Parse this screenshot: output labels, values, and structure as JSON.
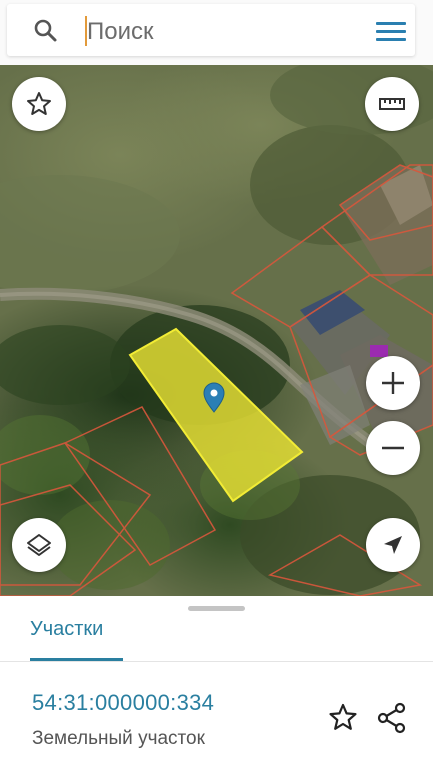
{
  "search": {
    "placeholder": "Поиск",
    "search_icon": "search-icon",
    "menu_icon": "hamburger-menu-icon"
  },
  "map": {
    "controls": {
      "favorite": "star-icon",
      "ruler": "ruler-icon",
      "zoom_in": "plus-icon",
      "zoom_out": "minus-icon",
      "layers": "layers-icon",
      "locate": "navigation-arrow-icon"
    },
    "selected_parcel_fill": "#e6e033",
    "parcel_border_color": "#d8573c",
    "marker_color": "#2b7fb5"
  },
  "sheet": {
    "tab_label": "Участки",
    "parcel": {
      "cadastral_number": "54:31:000000:334",
      "type": "Земельный участок"
    },
    "actions": {
      "favorite": "star-outline-icon",
      "share": "share-icon"
    },
    "accent_color": "#2a7fa0"
  }
}
